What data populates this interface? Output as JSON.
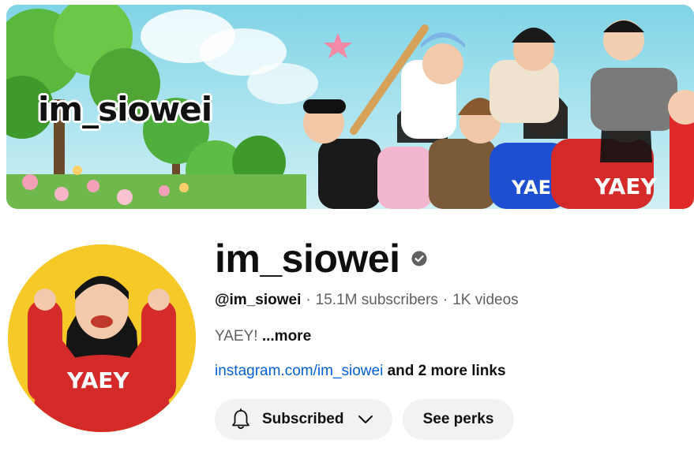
{
  "banner": {
    "title": "im_siowei",
    "colors": {
      "sky": "#8fd9e8",
      "tree": "#4fae3c",
      "hoodie_blue": "#1e4fd0",
      "hoodie_red": "#d42a2a"
    },
    "hoodie_text": "YAEY"
  },
  "avatar": {
    "background": "#f7c928",
    "hoodie_text": "YAEY"
  },
  "channel": {
    "name": "im_siowei",
    "verified_icon": "verified-check-icon",
    "handle": "@im_siowei",
    "subscribers": "15.1M subscribers",
    "videos": "1K videos",
    "separator": "·",
    "description": "YAEY!",
    "more_label": "...more",
    "link": "instagram.com/im_siowei",
    "more_links": "and 2 more links"
  },
  "actions": {
    "subscribed_label": "Subscribed",
    "perks_label": "See perks"
  }
}
